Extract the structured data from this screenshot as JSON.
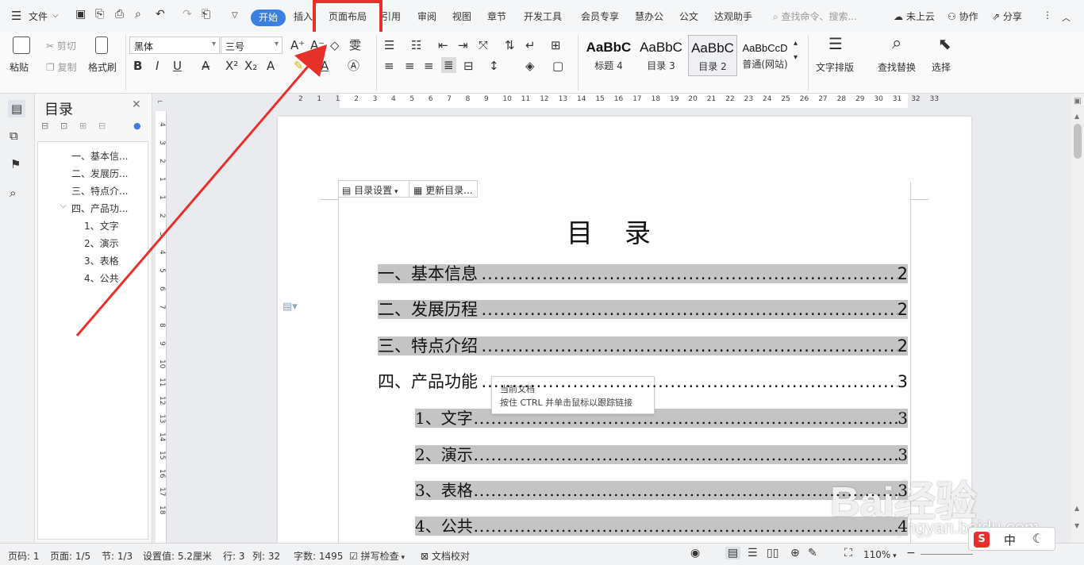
{
  "menubar": {
    "file_label": "文件",
    "tabs": [
      "开始",
      "插入",
      "页面布局",
      "引用",
      "审阅",
      "视图",
      "章节",
      "开发工具",
      "会员专享",
      "慧办公",
      "公文",
      "达观助手"
    ],
    "search_placeholder": "查找命令、搜索...",
    "cloud_label": "未上云",
    "collab_label": "协作",
    "share_label": "分享"
  },
  "ribbon": {
    "paste": "粘贴",
    "cut": "剪切",
    "copy": "复制",
    "format_painter": "格式刷",
    "font_name": "黑体",
    "font_size": "三号",
    "styles": [
      {
        "sample": "AaBbC",
        "name": "标题 4"
      },
      {
        "sample": "AaBbC",
        "name": "目录 3"
      },
      {
        "sample": "AaBbC",
        "name": "目录 2"
      },
      {
        "sample": "AaBbCcD",
        "name": "普通(网站)"
      }
    ],
    "text_layout": "文字排版",
    "find_replace": "查找替换",
    "select": "选择"
  },
  "toc_panel": {
    "title": "目录",
    "items": [
      "一、基本信...",
      "二、发展历...",
      "三、特点介...",
      "四、产品功...",
      "1、文字",
      "2、演示",
      "3、表格",
      "4、公共"
    ]
  },
  "document": {
    "toc_settings": "目录设置",
    "update_toc": "更新目录...",
    "title": "目录",
    "entries": [
      {
        "text": "一、基本信息",
        "page": "2"
      },
      {
        "text": "二、发展历程",
        "page": "2"
      },
      {
        "text": "三、特点介绍",
        "page": "2"
      },
      {
        "text": "四、产品功能",
        "page": "3"
      },
      {
        "text": "1、文字",
        "page": "3"
      },
      {
        "text": "2、演示",
        "page": "3"
      },
      {
        "text": "3、表格",
        "page": "3"
      },
      {
        "text": "4、公共",
        "page": "4"
      }
    ],
    "tooltip_line1": "当前文档",
    "tooltip_line2": "按住 CTRL 并单击鼠标以跟踪链接"
  },
  "ruler": {
    "h_ticks": [
      "2",
      "1",
      "1",
      "2",
      "3",
      "4",
      "5",
      "6",
      "7",
      "8",
      "9",
      "10",
      "11",
      "12",
      "13",
      "14",
      "15",
      "16",
      "17",
      "18",
      "19",
      "20",
      "21",
      "22",
      "23",
      "24",
      "25",
      "26",
      "27",
      "28",
      "29",
      "30",
      "31",
      "32",
      "33"
    ],
    "v_ticks": [
      "4",
      "3",
      "2",
      "1",
      "1",
      "2",
      "3",
      "4",
      "5",
      "6",
      "7",
      "8",
      "9",
      "10",
      "11",
      "12",
      "13",
      "14",
      "15",
      "16",
      "17",
      "18"
    ]
  },
  "statusbar": {
    "page_num": "页码: 1",
    "pages": "页面: 1/5",
    "section": "节: 1/3",
    "setting": "设置值: 5.2厘米",
    "row": "行: 3",
    "col": "列: 32",
    "word_count": "字数: 1495",
    "spell_check": "拼写检查",
    "doc_proof": "文档校对",
    "zoom": "110%"
  },
  "watermark": {
    "brand": "Bai经验",
    "url": "jingyan.baidu.com"
  },
  "ime": {
    "mode": "中"
  },
  "colors": {
    "accent": "#3b7fe5",
    "highlight_border": "#e8302b",
    "arrow": "#e8302b",
    "toc_shade": "#c4c4c4"
  }
}
